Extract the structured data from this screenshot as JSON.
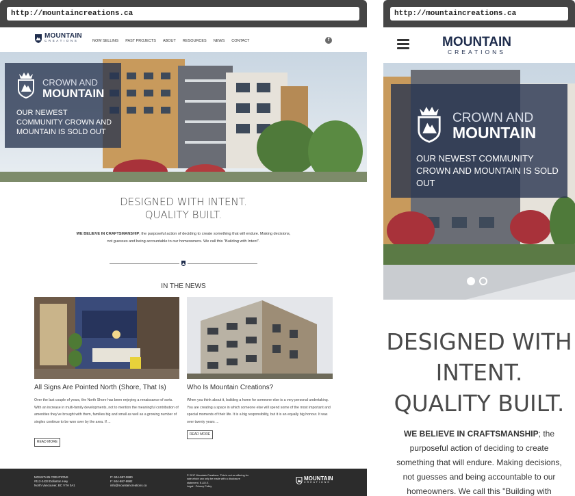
{
  "desktop": {
    "url": "http://mountaincreations.ca",
    "logo": {
      "name": "MOUNTAIN",
      "sub": "CREATIONS"
    },
    "nav": [
      "NOW SELLING",
      "PAST PROJECTS",
      "ABOUT",
      "RESOURCES",
      "NEWS",
      "CONTACT"
    ],
    "social_icon": "f",
    "hero": {
      "crown": "CROWN AND",
      "mountain": "MOUNTAIN",
      "subtitle": "OUR NEWEST COMMUNITY CROWN AND MOUNTAIN IS SOLD OUT"
    },
    "tagline_line1": "DESIGNED WITH INTENT.",
    "tagline_line2": "QUALITY BUILT.",
    "intro_bold": "WE BELIEVE IN CRAFTSMANSHIP",
    "intro_text": "; the purposeful action of deciding to create something that will endure. Making decisions, not guesses and being accountable to our homeowners. We call this \"Building with Intent\".",
    "news_heading": "IN THE NEWS",
    "articles": [
      {
        "title": "All Signs Are Pointed North (Shore, That Is)",
        "excerpt": "Over the last couple of years, the North Shore has been enjoying a renaissance of sorts. With an increase in multi-family developments, not to mention the meaningful contribution of amenities they've brought with them, families big and small as well as a growing number of singles continue to be won over by the area. If ...",
        "button": "READ MORE"
      },
      {
        "title": "Who Is Mountain Creations?",
        "excerpt": "When you think about it, building a home for someone else is a very personal undertaking. You are creating a space in which someone else will spend some of the most important and special moments of their life. It is a big responsibility, but it is an equally big honour. It was over twenty years ...",
        "button": "READ MORE"
      }
    ],
    "footer": {
      "company": "MOUNTAIN CREATIONS",
      "address1": "#112-2433 Dollarton Hwy",
      "address2": "North Vancouver, BC V7H 0A1",
      "phone": "P: 604-987-9980",
      "fax": "F: 604-987-9982",
      "email": "info@mountaincreations.ca",
      "legal1": "© 2017 Mountain Creations. This is not an offering for",
      "legal2": "sale which can only be made with a disclosure",
      "legal3": "statement. E.&O.E.",
      "legal4": "Legal · Privacy Policy",
      "logo_name": "MOUNTAIN",
      "logo_sub": "CREATIONS"
    }
  },
  "mobile": {
    "url": "http://mountaincreations.ca",
    "logo": {
      "name": "MOUNTAIN",
      "sub": "CREATIONS"
    },
    "hero": {
      "crown": "CROWN AND",
      "mountain": "MOUNTAIN",
      "subtitle": "OUR NEWEST COMMUNITY CROWN AND MOUNTAIN IS SOLD OUT"
    },
    "tagline_line1": "DESIGNED WITH",
    "tagline_line2": "INTENT.",
    "tagline_line3": "QUALITY BUILT.",
    "intro_bold": "WE BELIEVE IN CRAFTSMANSHIP",
    "intro_text": "; the purposeful action of deciding to create something that will endure. Making decisions, not guesses and being accountable to our homeowners. We call this \"Building with Intent\"."
  },
  "colors": {
    "brand_navy": "#1f2d4d",
    "overlay": "#283450",
    "browser_chrome": "#454545",
    "footer_bg": "#2c2c2c"
  },
  "icons": [
    "facebook-icon",
    "crest-icon",
    "hamburger-menu-icon",
    "divider-mountain-icon"
  ]
}
